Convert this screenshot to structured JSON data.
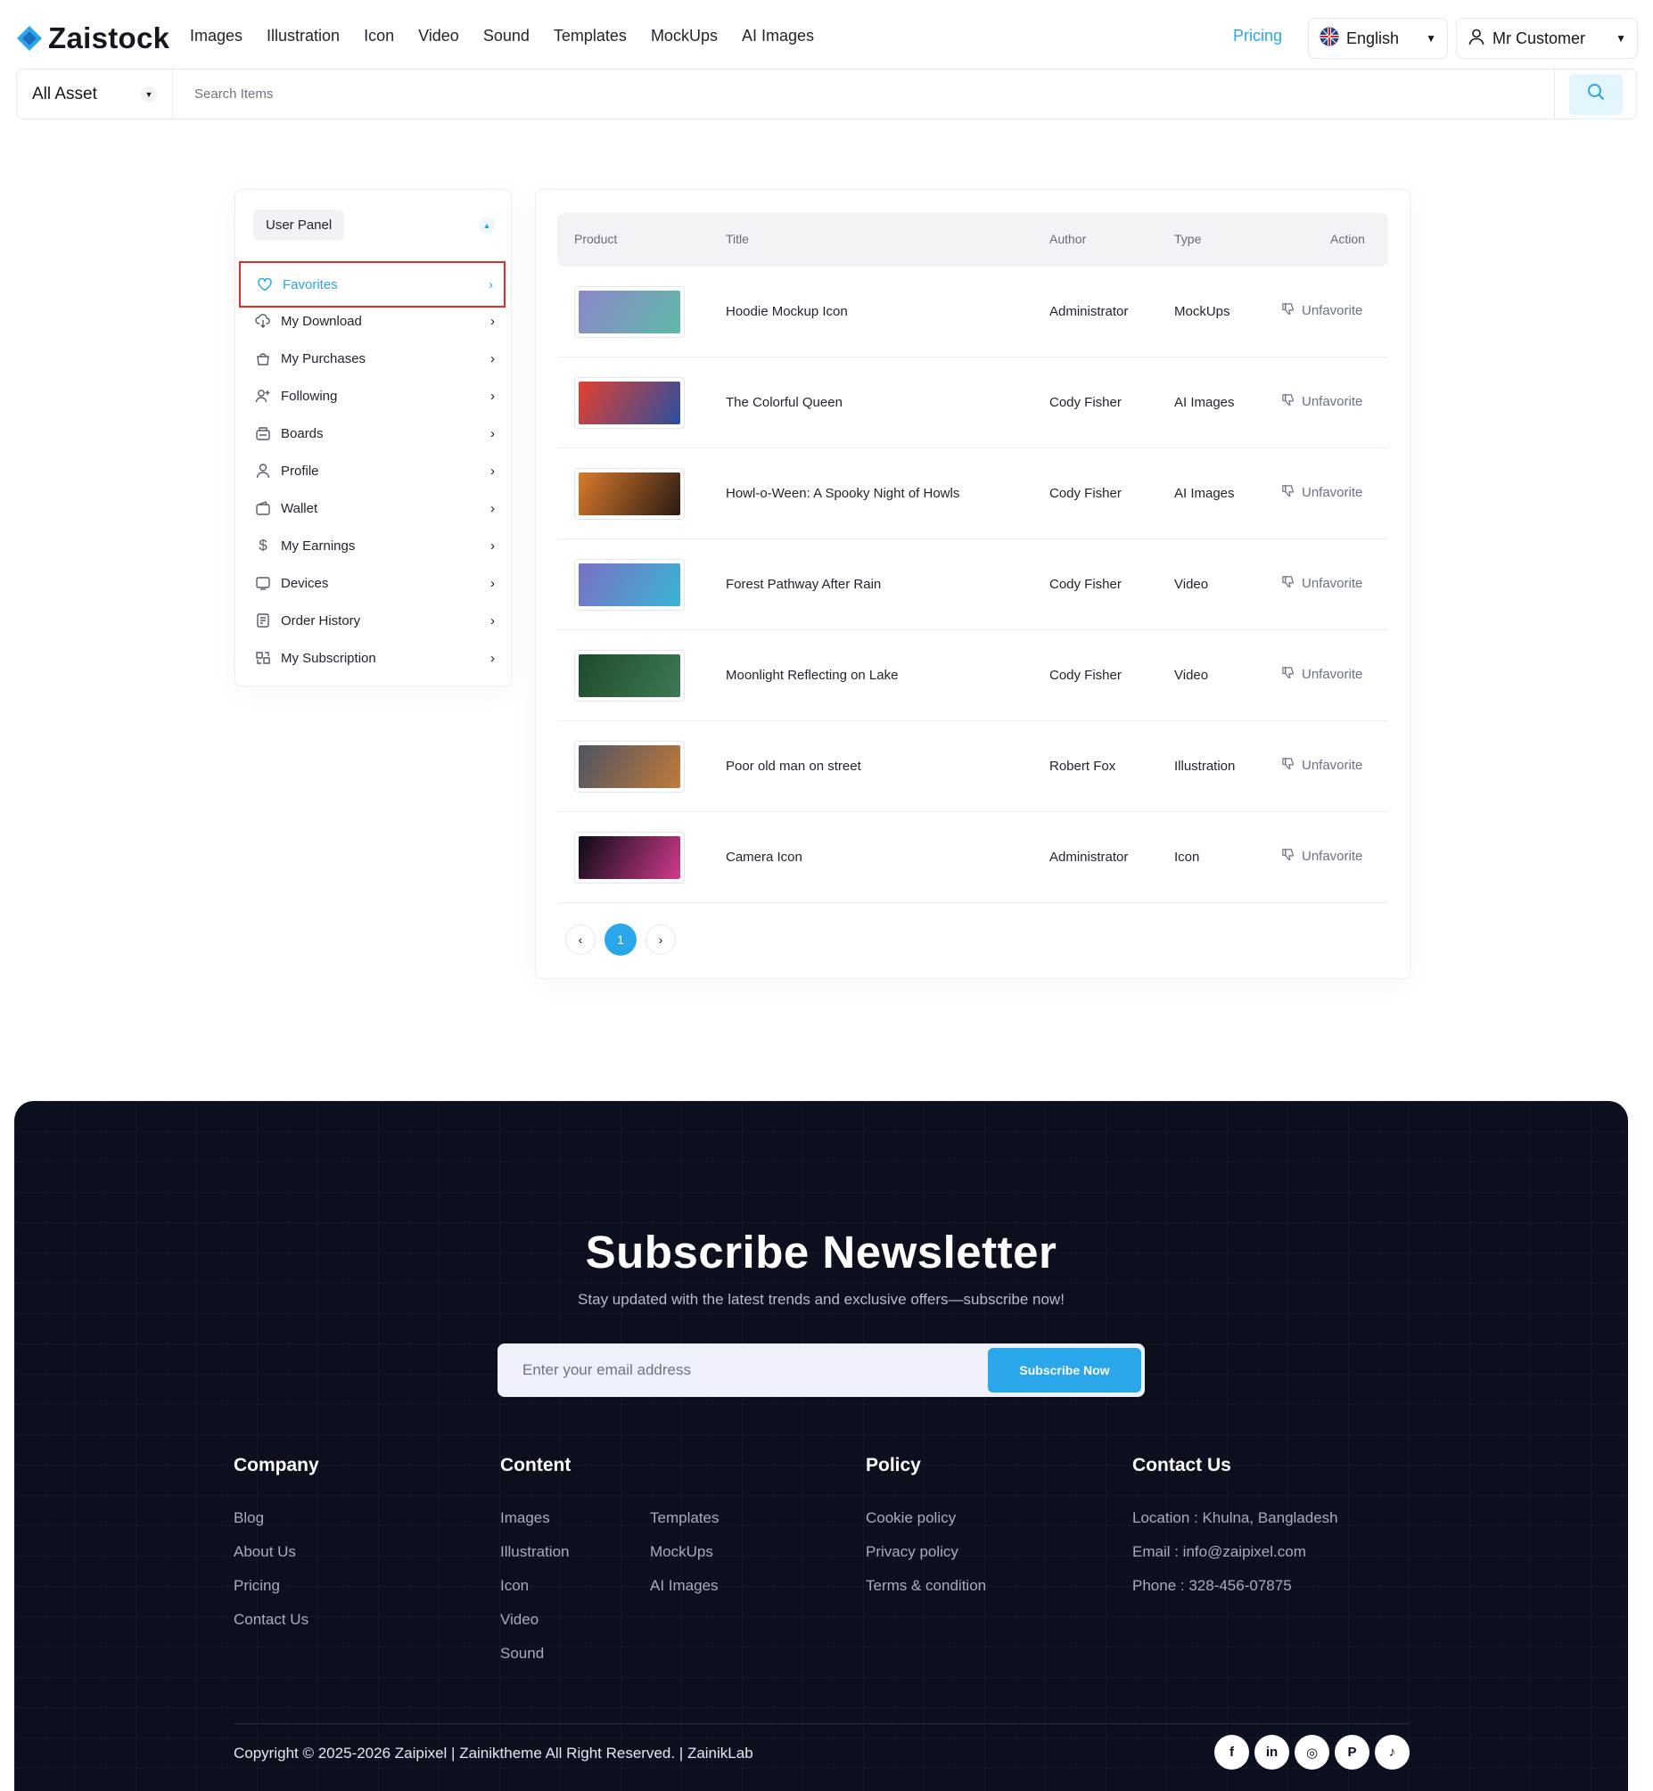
{
  "header": {
    "logo_text": "Zaistock",
    "nav": [
      "Images",
      "Illustration",
      "Icon",
      "Video",
      "Sound",
      "Templates",
      "MockUps",
      "AI Images"
    ],
    "pricing": "Pricing",
    "language": "English",
    "user": "Mr Customer"
  },
  "search": {
    "category": "All Asset",
    "placeholder": "Search Items"
  },
  "sidebar": {
    "title": "User Panel",
    "items": [
      {
        "label": "Favorites",
        "icon": "heart-icon",
        "active": true
      },
      {
        "label": "My Download",
        "icon": "cloud-download-icon"
      },
      {
        "label": "My Purchases",
        "icon": "shopping-bag-icon"
      },
      {
        "label": "Following",
        "icon": "user-plus-icon"
      },
      {
        "label": "Boards",
        "icon": "board-icon"
      },
      {
        "label": "Profile",
        "icon": "user-icon"
      },
      {
        "label": "Wallet",
        "icon": "wallet-icon"
      },
      {
        "label": "My Earnings",
        "icon": "dollar-icon"
      },
      {
        "label": "Devices",
        "icon": "device-icon"
      },
      {
        "label": "Order History",
        "icon": "receipt-icon"
      },
      {
        "label": "My Subscription",
        "icon": "subscription-icon"
      }
    ]
  },
  "table": {
    "headers": [
      "Product",
      "Title",
      "Author",
      "Type",
      "Action"
    ],
    "action_label": "Unfavorite",
    "rows": [
      {
        "title": "Hoodie Mockup Icon",
        "author": "Administrator",
        "type": "MockUps",
        "thumb_colors": [
          "#8d86c9",
          "#5fb9a8"
        ]
      },
      {
        "title": "The Colorful Queen",
        "author": "Cody Fisher",
        "type": "AI Images",
        "thumb_colors": [
          "#e3402e",
          "#2a4fa0"
        ]
      },
      {
        "title": "Howl-o-Ween: A Spooky Night of Howls",
        "author": "Cody Fisher",
        "type": "AI Images",
        "thumb_colors": [
          "#d97a2b",
          "#2a1a14"
        ]
      },
      {
        "title": "Forest Pathway After Rain",
        "author": "Cody Fisher",
        "type": "Video",
        "thumb_colors": [
          "#7a6fc4",
          "#39b4d4"
        ]
      },
      {
        "title": "Moonlight Reflecting on Lake",
        "author": "Cody Fisher",
        "type": "Video",
        "thumb_colors": [
          "#1f4a2c",
          "#3c7a56"
        ]
      },
      {
        "title": "Poor old man on street",
        "author": "Robert Fox",
        "type": "Illustration",
        "thumb_colors": [
          "#4e5363",
          "#c07a3a"
        ]
      },
      {
        "title": "Camera Icon",
        "author": "Administrator",
        "type": "Icon",
        "thumb_colors": [
          "#0a0a14",
          "#d03b8c"
        ]
      }
    ],
    "pagination": {
      "prev": "‹",
      "current": "1",
      "next": "›"
    }
  },
  "footer": {
    "newsletter_title": "Subscribe Newsletter",
    "newsletter_subtitle": "Stay updated with the latest trends and exclusive offers—subscribe now!",
    "email_placeholder": "Enter your email address",
    "subscribe_button": "Subscribe Now",
    "company": {
      "title": "Company",
      "links": [
        "Blog",
        "About Us",
        "Pricing",
        "Contact Us"
      ]
    },
    "content": {
      "title": "Content",
      "links_a": [
        "Images",
        "Illustration",
        "Icon",
        "Video",
        "Sound"
      ],
      "links_b": [
        "Templates",
        "MockUps",
        "AI Images"
      ]
    },
    "policy": {
      "title": "Policy",
      "links": [
        "Cookie policy",
        "Privacy policy",
        "Terms & condition"
      ]
    },
    "contact": {
      "title": "Contact Us",
      "lines": [
        "Location : Khulna, Bangladesh",
        "Email : info@zaipixel.com",
        "Phone : 328-456-07875"
      ]
    },
    "copyright": "Copyright © 2025-2026 Zaipixel | Zainiktheme All Right Reserved. | ZainikLab",
    "socials": [
      {
        "name": "facebook-icon",
        "glyph": "f"
      },
      {
        "name": "linkedin-icon",
        "glyph": "in"
      },
      {
        "name": "instagram-icon",
        "glyph": "◎"
      },
      {
        "name": "pinterest-icon",
        "glyph": "P"
      },
      {
        "name": "tiktok-icon",
        "glyph": "♪"
      }
    ]
  },
  "colors": {
    "accent": "#2aa6ea",
    "active_outline": "#e52a2a",
    "footer_bg": "#0b0f1e"
  }
}
